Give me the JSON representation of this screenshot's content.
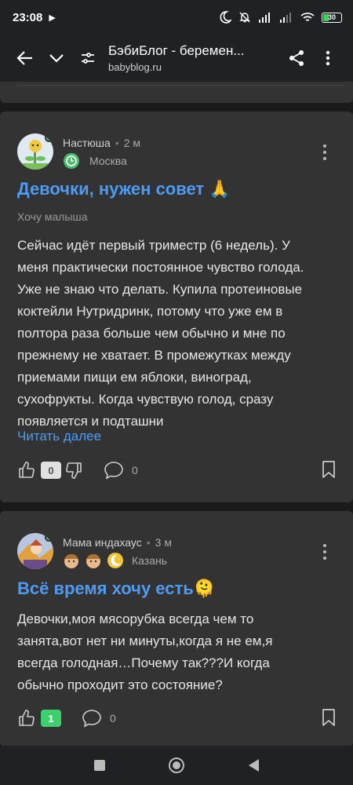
{
  "status_bar": {
    "time": "23:08",
    "battery": "30"
  },
  "toolbar": {
    "title": "БэбиБлог - беремен...",
    "url": "babyblog.ru"
  },
  "posts": [
    {
      "author": "Настюша",
      "time": "2 м",
      "city": "Москва",
      "title": "Девочки, нужен совет 🙏",
      "tag": "Хочу малыша",
      "body_lines": [
        "Сейчас идёт первый триместр (6 недель). У",
        "меня практически постоянное чувство голода.",
        "Уже не знаю что делать. Купила протеиновые",
        "коктейли Нутридринк, потому что уже ем в",
        "полтора раза больше чем обычно и мне по",
        "прежнему не хватает. В промежутках между",
        "приемами пищи ем яблоки, виноград,",
        "сухофрукты. Когда чувствую голод, сразу",
        "появляется и подташни"
      ],
      "read_more": "Читать далее",
      "likes": "0",
      "comments": "0"
    },
    {
      "author": "Мама индахаус",
      "time": "3 м",
      "city": "Казань",
      "title": "Всё время хочу есть🫠",
      "body_lines": [
        "Девочки,моя мясорубка всегда чем то",
        "занята,вот нет ни минуты,когда я не ем,я",
        "всегда голодная…Почему так???И когда",
        "обычно проходит это состояние?"
      ],
      "likes": "1",
      "comments": "0"
    }
  ],
  "colors": {
    "accent": "#4d9bf2",
    "online": "#3ecf5c",
    "card": "#333333"
  }
}
